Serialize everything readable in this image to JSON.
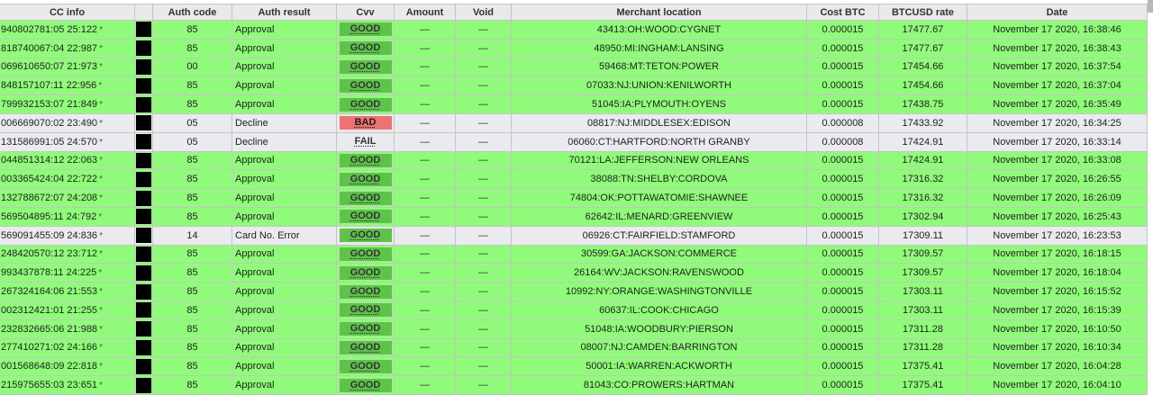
{
  "columns": [
    "CC info",
    "",
    "Auth code",
    "Auth result",
    "Cvv",
    "Amount",
    "Void",
    "Merchant location",
    "Cost BTC",
    "BTCUSD rate",
    "Date"
  ],
  "star": "*",
  "rows": [
    {
      "cc": "940802781:05 25:122",
      "auth_code": "85",
      "result": "Approval",
      "cvv": "GOOD",
      "amount": "—",
      "void": "—",
      "location": "43413:OH:WOOD:CYGNET",
      "cost": "0.000015",
      "rate": "17477.67",
      "date": "November 17 2020, 16:38:46",
      "status": "ok"
    },
    {
      "cc": "818740067:04 22:987",
      "auth_code": "85",
      "result": "Approval",
      "cvv": "GOOD",
      "amount": "—",
      "void": "—",
      "location": "48950:MI:INGHAM:LANSING",
      "cost": "0.000015",
      "rate": "17477.67",
      "date": "November 17 2020, 16:38:43",
      "status": "ok"
    },
    {
      "cc": "069610650:07 21:973",
      "auth_code": "00",
      "result": "Approval",
      "cvv": "GOOD",
      "amount": "—",
      "void": "—",
      "location": "59468:MT:TETON:POWER",
      "cost": "0.000015",
      "rate": "17454.66",
      "date": "November 17 2020, 16:37:54",
      "status": "ok"
    },
    {
      "cc": "848157107:11 22:956",
      "auth_code": "85",
      "result": "Approval",
      "cvv": "GOOD",
      "amount": "—",
      "void": "—",
      "location": "07033:NJ:UNION:KENILWORTH",
      "cost": "0.000015",
      "rate": "17454.66",
      "date": "November 17 2020, 16:37:04",
      "status": "ok"
    },
    {
      "cc": "799932153:07 21:849",
      "auth_code": "85",
      "result": "Approval",
      "cvv": "GOOD",
      "amount": "—",
      "void": "—",
      "location": "51045:IA:PLYMOUTH:OYENS",
      "cost": "0.000015",
      "rate": "17438.75",
      "date": "November 17 2020, 16:35:49",
      "status": "ok"
    },
    {
      "cc": "006669070:02 23:490",
      "auth_code": "05",
      "result": "Decline",
      "cvv": "BAD",
      "amount": "—",
      "void": "—",
      "location": "08817:NJ:MIDDLESEX:EDISON",
      "cost": "0.000008",
      "rate": "17433.92",
      "date": "November 17 2020, 16:34:25",
      "status": "declined"
    },
    {
      "cc": "131586991:05 24:570",
      "auth_code": "05",
      "result": "Decline",
      "cvv": "FAIL",
      "amount": "—",
      "void": "—",
      "location": "06060:CT:HARTFORD:NORTH GRANBY",
      "cost": "0.000008",
      "rate": "17424.91",
      "date": "November 17 2020, 16:33:14",
      "status": "declined"
    },
    {
      "cc": "044851314:12 22:063",
      "auth_code": "85",
      "result": "Approval",
      "cvv": "GOOD",
      "amount": "—",
      "void": "—",
      "location": "70121:LA:JEFFERSON:NEW ORLEANS",
      "cost": "0.000015",
      "rate": "17424.91",
      "date": "November 17 2020, 16:33:08",
      "status": "ok"
    },
    {
      "cc": "003365424:04 22:722",
      "auth_code": "85",
      "result": "Approval",
      "cvv": "GOOD",
      "amount": "—",
      "void": "—",
      "location": "38088:TN:SHELBY:CORDOVA",
      "cost": "0.000015",
      "rate": "17316.32",
      "date": "November 17 2020, 16:26:55",
      "status": "ok"
    },
    {
      "cc": "132788672:07 24:208",
      "auth_code": "85",
      "result": "Approval",
      "cvv": "GOOD",
      "amount": "—",
      "void": "—",
      "location": "74804:OK:POTTAWATOMIE:SHAWNEE",
      "cost": "0.000015",
      "rate": "17316.32",
      "date": "November 17 2020, 16:26:09",
      "status": "ok"
    },
    {
      "cc": "569504895:11 24:792",
      "auth_code": "85",
      "result": "Approval",
      "cvv": "GOOD",
      "amount": "—",
      "void": "—",
      "location": "62642:IL:MENARD:GREENVIEW",
      "cost": "0.000015",
      "rate": "17302.94",
      "date": "November 17 2020, 16:25:43",
      "status": "ok"
    },
    {
      "cc": "569091455:09 24:836",
      "auth_code": "14",
      "result": "Card No. Error",
      "cvv": "GOOD",
      "amount": "—",
      "void": "—",
      "location": "06926:CT:FAIRFIELD:STAMFORD",
      "cost": "0.000015",
      "rate": "17309.11",
      "date": "November 17 2020, 16:23:53",
      "status": "declined"
    },
    {
      "cc": "248420570:12 23:712",
      "auth_code": "85",
      "result": "Approval",
      "cvv": "GOOD",
      "amount": "—",
      "void": "—",
      "location": "30599:GA:JACKSON:COMMERCE",
      "cost": "0.000015",
      "rate": "17309.57",
      "date": "November 17 2020, 16:18:15",
      "status": "ok"
    },
    {
      "cc": "993437878:11 24:225",
      "auth_code": "85",
      "result": "Approval",
      "cvv": "GOOD",
      "amount": "—",
      "void": "—",
      "location": "26164:WV:JACKSON:RAVENSWOOD",
      "cost": "0.000015",
      "rate": "17309.57",
      "date": "November 17 2020, 16:18:04",
      "status": "ok"
    },
    {
      "cc": "267324164:06 21:553",
      "auth_code": "85",
      "result": "Approval",
      "cvv": "GOOD",
      "amount": "—",
      "void": "—",
      "location": "10992:NY:ORANGE:WASHINGTONVILLE",
      "cost": "0.000015",
      "rate": "17303.11",
      "date": "November 17 2020, 16:15:52",
      "status": "ok"
    },
    {
      "cc": "002312421:01 21:255",
      "auth_code": "85",
      "result": "Approval",
      "cvv": "GOOD",
      "amount": "—",
      "void": "—",
      "location": "60637:IL:COOK:CHICAGO",
      "cost": "0.000015",
      "rate": "17303.11",
      "date": "November 17 2020, 16:15:39",
      "status": "ok"
    },
    {
      "cc": "232832665:06 21:988",
      "auth_code": "85",
      "result": "Approval",
      "cvv": "GOOD",
      "amount": "—",
      "void": "—",
      "location": "51048:IA:WOODBURY:PIERSON",
      "cost": "0.000015",
      "rate": "17311.28",
      "date": "November 17 2020, 16:10:50",
      "status": "ok"
    },
    {
      "cc": "277410271:02 24:166",
      "auth_code": "85",
      "result": "Approval",
      "cvv": "GOOD",
      "amount": "—",
      "void": "—",
      "location": "08007:NJ:CAMDEN:BARRINGTON",
      "cost": "0.000015",
      "rate": "17311.28",
      "date": "November 17 2020, 16:10:34",
      "status": "ok"
    },
    {
      "cc": "001568648:09 22:818",
      "auth_code": "85",
      "result": "Approval",
      "cvv": "GOOD",
      "amount": "—",
      "void": "—",
      "location": "50001:IA:WARREN:ACKWORTH",
      "cost": "0.000015",
      "rate": "17375.41",
      "date": "November 17 2020, 16:04:28",
      "status": "ok"
    },
    {
      "cc": "215975655:03 23:651",
      "auth_code": "85",
      "result": "Approval",
      "cvv": "GOOD",
      "amount": "—",
      "void": "—",
      "location": "81043:CO:PROWERS:HARTMAN",
      "cost": "0.000015",
      "rate": "17375.41",
      "date": "November 17 2020, 16:04:10",
      "status": "ok"
    }
  ],
  "colors": {
    "approved_row": "#90fb7a",
    "declined_row": "#e9ebee",
    "cvv_good": "#5ec24b",
    "cvv_bad": "#ee7272",
    "header_bg": "#e9e9e9"
  }
}
